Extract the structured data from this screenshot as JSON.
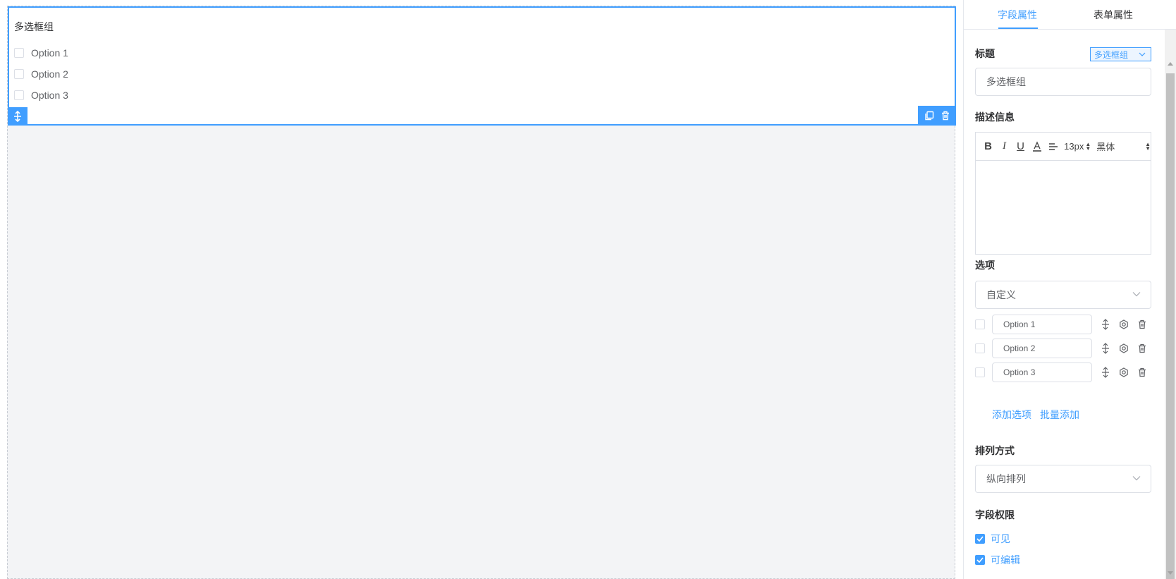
{
  "canvas": {
    "field": {
      "title": "多选框组",
      "options": [
        "Option 1",
        "Option 2",
        "Option 3"
      ]
    }
  },
  "panel": {
    "tabs": {
      "field_props": "字段属性",
      "form_props": "表单属性"
    },
    "title_label": "标题",
    "field_type": "多选框组",
    "title_value": "多选框组",
    "desc_label": "描述信息",
    "editor": {
      "bold": "B",
      "italic": "I",
      "underline": "U",
      "color": "A",
      "font_size": "13px",
      "font_family": "黑体"
    },
    "options_label": "选项",
    "options_source": "自定义",
    "option_rows": [
      "Option 1",
      "Option 2",
      "Option 3"
    ],
    "add_option": "添加选项",
    "batch_add": "批量添加",
    "layout_label": "排列方式",
    "layout_value": "纵向排列",
    "perm_label": "字段权限",
    "perm_visible": "可见",
    "perm_editable": "可编辑"
  },
  "colors": {
    "accent": "#409eff",
    "canvas_bg": "#f3f4f6",
    "border": "#dcdfe6"
  }
}
